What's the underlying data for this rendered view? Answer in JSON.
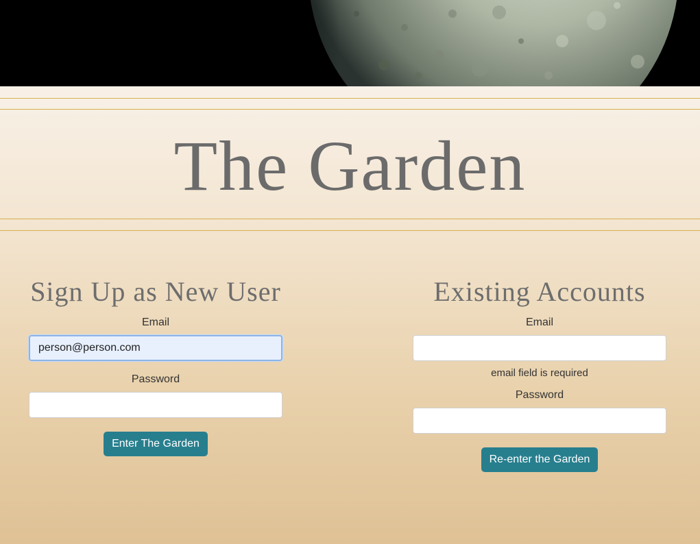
{
  "hero": {
    "image": "moon-surface-image"
  },
  "site": {
    "title": "The Garden"
  },
  "signup": {
    "heading": "Sign Up as New User",
    "email_label": "Email",
    "email_value": "person@person.com",
    "password_label": "Password",
    "password_value": "",
    "submit_label": "Enter The Garden"
  },
  "login": {
    "heading": "Existing Accounts",
    "email_label": "Email",
    "email_value": "",
    "email_error": "email field is required",
    "password_label": "Password",
    "password_value": "",
    "submit_label": "Re-enter the Garden"
  },
  "colors": {
    "accent_button": "#277f8e",
    "rule": "#d6b14e",
    "title_text": "#6b6b6b"
  }
}
